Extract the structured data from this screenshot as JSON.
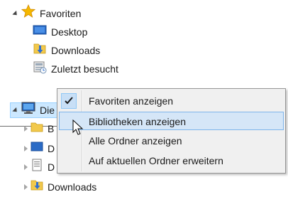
{
  "tree": {
    "favorites": {
      "label": "Favoriten",
      "icon": "star-icon",
      "expanded": true
    },
    "favorite_items": [
      {
        "label": "Desktop",
        "icon": "desktop-folder-icon"
      },
      {
        "label": "Downloads",
        "icon": "downloads-folder-icon"
      },
      {
        "label": "Zuletzt besucht",
        "icon": "recent-places-icon"
      }
    ],
    "this_pc": {
      "label": "Die",
      "icon": "computer-icon",
      "expanded": true
    },
    "this_pc_children": [
      {
        "label": "B",
        "icon": "folder-icon"
      },
      {
        "label": "D",
        "icon": "desktop-folder-icon"
      },
      {
        "label": "D",
        "icon": "documents-folder-icon"
      },
      {
        "label": "Downloads",
        "icon": "downloads-folder-icon"
      }
    ]
  },
  "context_menu": {
    "items": [
      {
        "label": "Favoriten anzeigen",
        "checked": true
      },
      {
        "label": "Bibliotheken anzeigen",
        "hovered": true
      },
      {
        "label": "Alle Ordner anzeigen"
      },
      {
        "label": "Auf aktuellen Ordner erweitern"
      }
    ]
  },
  "colors": {
    "menu_background": "#f0f0f0",
    "menu_hover": "#d5e6f7",
    "menu_hover_border": "#7eb4ea",
    "check_background": "#c8dff6",
    "star": "#f5b800",
    "folder": "#f2c94c",
    "download_arrow": "#2f6fd4"
  }
}
